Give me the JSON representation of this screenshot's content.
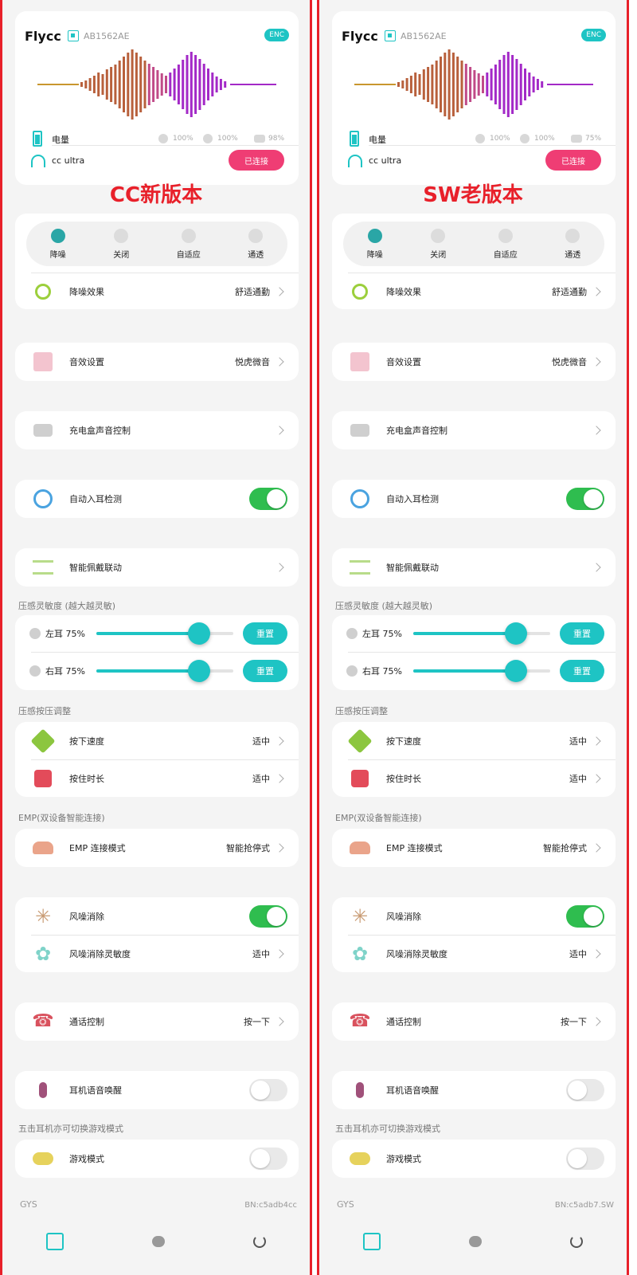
{
  "panels": [
    {
      "app_title": "Flycc",
      "serial": "AB1562AE",
      "enc_badge": "ENC",
      "battery_label": "电量",
      "battery_left": "100%",
      "battery_right": "100%",
      "battery_case": "98%",
      "device_name": "cc ultra",
      "connected_label": "已连接",
      "caption": "CC新版本",
      "modes": [
        "降噪",
        "关闭",
        "自适应",
        "通透"
      ],
      "anc_effect_label": "降噪效果",
      "anc_effect_value": "舒适通勤",
      "sound_label": "音效设置",
      "sound_value": "悦虎微音",
      "case_sound_label": "充电盒声音控制",
      "in_ear_label": "自动入耳检测",
      "smart_wear_label": "智能佩戴联动",
      "pressure_section": "压感灵敏度 (越大越灵敏)",
      "left_ear_label": "左耳 75%",
      "right_ear_label": "右耳 75%",
      "left_ear_level": 0.75,
      "right_ear_level": 0.75,
      "reset_label": "重置",
      "press_section": "压感按压调整",
      "press_speed_label": "按下速度",
      "press_speed_value": "适中",
      "hold_time_label": "按住时长",
      "hold_time_value": "适中",
      "emp_section": "EMP(双设备智能连接)",
      "emp_label": "EMP 连接模式",
      "emp_value": "智能抢停式",
      "wind_label": "风噪消除",
      "wind_sens_label": "风噪消除灵敏度",
      "wind_sens_value": "适中",
      "call_label": "通话控制",
      "call_value": "按一下",
      "voice_label": "耳机语音唤醒",
      "game_section": "五击耳机亦可切换游戏模式",
      "game_label": "游戏模式",
      "footer_left": "GYS",
      "footer_right": "BN:c5adb4cc"
    },
    {
      "app_title": "Flycc",
      "serial": "AB1562AE",
      "enc_badge": "ENC",
      "battery_label": "电量",
      "battery_left": "100%",
      "battery_right": "100%",
      "battery_case": "75%",
      "device_name": "cc ultra",
      "connected_label": "已连接",
      "caption": "SW老版本",
      "modes": [
        "降噪",
        "关闭",
        "自适应",
        "通透"
      ],
      "anc_effect_label": "降噪效果",
      "anc_effect_value": "舒适通勤",
      "sound_label": "音效设置",
      "sound_value": "悦虎微音",
      "case_sound_label": "充电盒声音控制",
      "in_ear_label": "自动入耳检测",
      "smart_wear_label": "智能佩戴联动",
      "pressure_section": "压感灵敏度 (越大越灵敏)",
      "left_ear_label": "左耳 75%",
      "right_ear_label": "右耳 75%",
      "left_ear_level": 0.75,
      "right_ear_level": 0.75,
      "reset_label": "重置",
      "press_section": "压感按压调整",
      "press_speed_label": "按下速度",
      "press_speed_value": "适中",
      "hold_time_label": "按住时长",
      "hold_time_value": "适中",
      "emp_section": "EMP(双设备智能连接)",
      "emp_label": "EMP 连接模式",
      "emp_value": "智能抢停式",
      "wind_label": "风噪消除",
      "wind_sens_label": "风噪消除灵敏度",
      "wind_sens_value": "适中",
      "call_label": "通话控制",
      "call_value": "按一下",
      "voice_label": "耳机语音唤醒",
      "game_section": "五击耳机亦可切换游戏模式",
      "game_label": "游戏模式",
      "footer_left": "GYS",
      "footer_right": "BN:c5adb7.SW"
    }
  ],
  "colors": {
    "accent": "#1ec4c4",
    "connected": "#ef3d74",
    "toggle_on": "#2fbd4f",
    "caption": "#e8202a",
    "frame": "#e8202a"
  }
}
